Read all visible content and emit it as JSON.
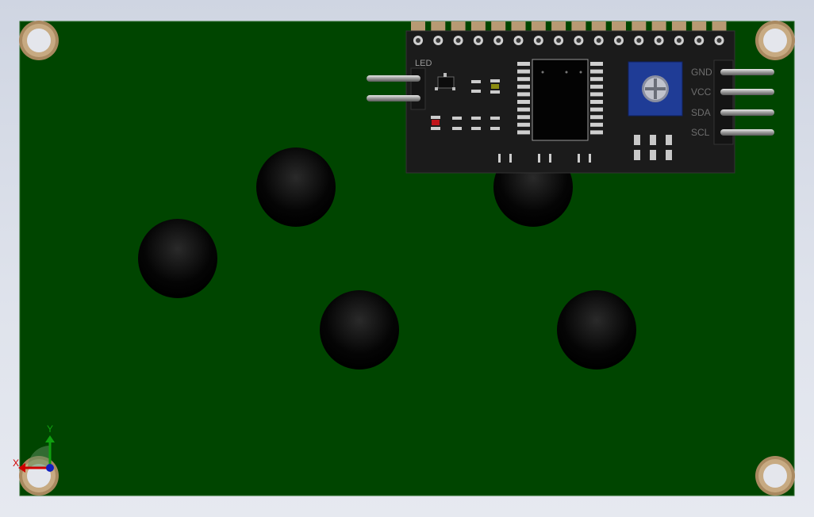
{
  "window": {
    "background": "#d8dde8"
  },
  "board": {
    "color": "#004500",
    "edge_color": "#1a5a1a",
    "mount_hole_ring_color": "#b89a73",
    "mount_holes": 4,
    "bosses": 5
  },
  "i2c_module": {
    "color": "#1b1b1b",
    "silk_led_label": "LED",
    "pin_labels": [
      "GND",
      "VCC",
      "SDA",
      "SCL"
    ],
    "header_pins": 16,
    "pot_color": "#1f3c96"
  },
  "triad": {
    "x_label": "X",
    "y_label": "Y",
    "x_color": "#d00000",
    "y_color": "#10a010",
    "z_color": "#1020c0"
  }
}
